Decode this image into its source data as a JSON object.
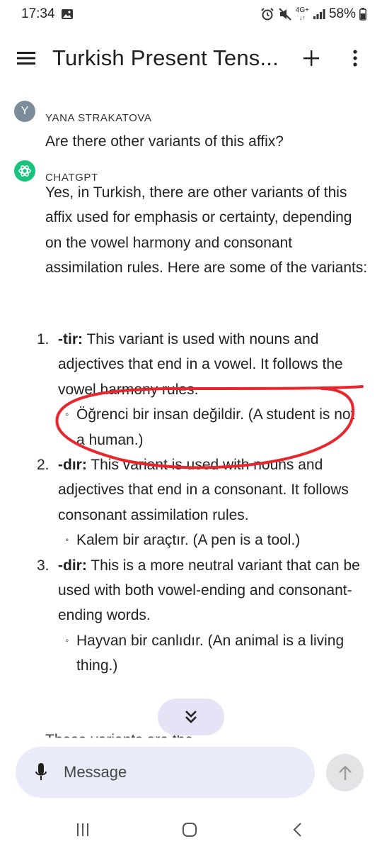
{
  "status_bar": {
    "time": "17:34",
    "network": "4G+",
    "battery": "58%"
  },
  "app_bar": {
    "title": "Turkish Present Tens..."
  },
  "conversation": {
    "user_message": {
      "avatar_letter": "Y",
      "author": "YANA STRAKATOVA",
      "text": "Are there other variants of this affix?"
    },
    "assistant_message": {
      "author": "CHATGPT",
      "intro": "Yes, in Turkish, there are other variants of this affix used for emphasis or certainty, depending on the vowel harmony and consonant assimilation rules. Here are some of the variants:",
      "variants": [
        {
          "number": "1.",
          "term": "-tir:",
          "description": " This variant is used with nouns and adjectives that end in a vowel. It follows the vowel harmony rules.",
          "example": "Öğrenci bir insan değildir. (A student is not a human.)"
        },
        {
          "number": "2.",
          "term": "-dır:",
          "description": " This variant is used with nouns and adjectives that end in a consonant. It follows consonant assimilation rules.",
          "example": "Kalem bir araçtır. (A pen is a tool.)"
        },
        {
          "number": "3.",
          "term": "-dir:",
          "description": " This is a more neutral variant that can be used with both vowel-ending and consonant-ending words.",
          "example": "Hayvan bir canlıdır. (An animal is a living thing.)"
        }
      ],
      "trailing_partial": "These variants are the..."
    }
  },
  "composer": {
    "placeholder": "Message"
  },
  "colors": {
    "accent_purple_pill": "#e7e3f7",
    "composer_bg": "#e9ecf8",
    "chatgpt_green": "#19c37d",
    "annotation_red": "#e8262e"
  }
}
